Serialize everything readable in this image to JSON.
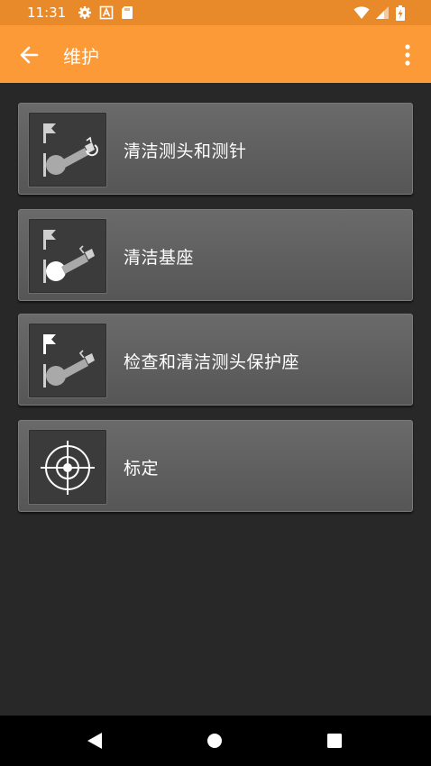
{
  "status_bar": {
    "time": "11:31",
    "left_icons": [
      "gear-icon",
      "a-icon",
      "sd-card-icon"
    ],
    "right_icons": [
      "wifi-icon",
      "cellular-icon",
      "battery-icon"
    ]
  },
  "app_bar": {
    "title": "维护",
    "back_icon": "arrow-left-icon",
    "menu_icon": "more-vertical-icon",
    "color": "#fb9a37"
  },
  "maintenance_items": [
    {
      "label": "清洁测头和测针",
      "icon": "probe-stylus-icon"
    },
    {
      "label": "清洁基座",
      "icon": "probe-base-icon"
    },
    {
      "label": "检查和清洁测头保护座",
      "icon": "probe-holder-icon"
    },
    {
      "label": "标定",
      "icon": "crosshair-target-icon"
    }
  ],
  "nav_bar": {
    "buttons": [
      "back-triangle-icon",
      "home-circle-icon",
      "recents-square-icon"
    ]
  }
}
